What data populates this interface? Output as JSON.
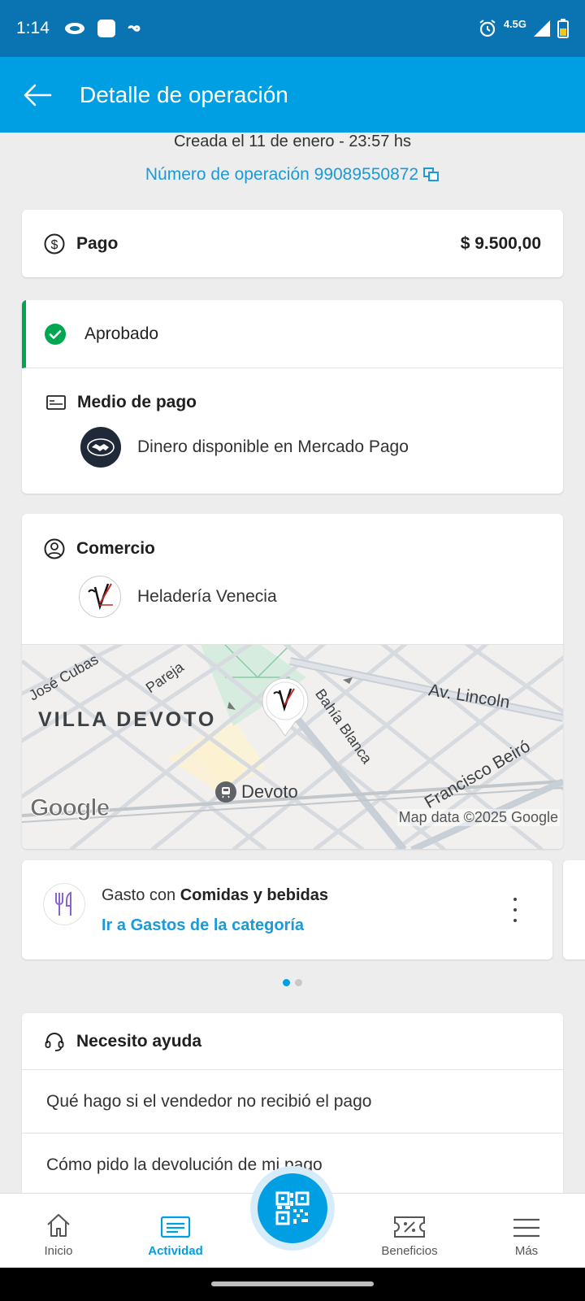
{
  "status_bar": {
    "time": "1:14",
    "network": "4.5G"
  },
  "app_bar": {
    "title": "Detalle de operación"
  },
  "operation": {
    "created": "Creada el 11 de enero - 23:57 hs",
    "number": "Número de operación 99089550872"
  },
  "payment": {
    "label": "Pago",
    "amount": "$ 9.500,00"
  },
  "status": {
    "label": "Aprobado",
    "color": "#00a650"
  },
  "payment_method": {
    "title": "Medio de pago",
    "value": "Dinero disponible en Mercado Pago"
  },
  "merchant": {
    "title": "Comercio",
    "name": "Heladería Venecia"
  },
  "map": {
    "area": "VILLA DEVOTO",
    "streets": [
      "José Cubas",
      "Pareja",
      "Bahía Blanca",
      "Av. Lincoln",
      "Francisco Beiró"
    ],
    "station": "Devoto",
    "logo": "Google",
    "copyright": "Map data ©2025 Google"
  },
  "category": {
    "prefix": "Gasto con ",
    "name": "Comidas y bebidas",
    "link": "Ir a Gastos de la categoría"
  },
  "help": {
    "title": "Necesito ayuda",
    "items": [
      "Qué hago si el vendedor no recibió el pago",
      "Cómo pido la devolución de mi pago"
    ]
  },
  "bottom_nav": {
    "items": [
      "Inicio",
      "Actividad",
      "Beneficios",
      "Más"
    ],
    "active": "Actividad"
  },
  "colors": {
    "app_bar": "#009ee3",
    "status_bar": "#0a74b3",
    "link": "#1b9ad8"
  }
}
